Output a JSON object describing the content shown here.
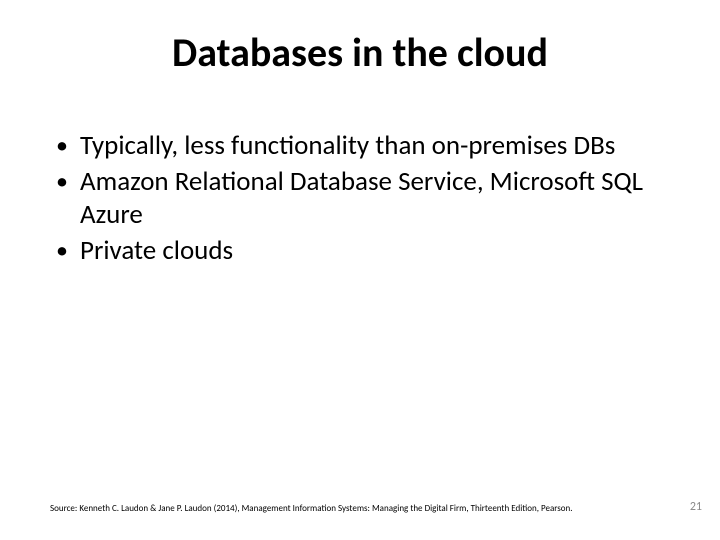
{
  "title": "Databases in the cloud",
  "bullets": [
    "Typically, less functionality than on-premises DBs",
    "Amazon Relational Database Service, Microsoft SQL Azure",
    "Private clouds"
  ],
  "source": "Source: Kenneth C. Laudon & Jane P. Laudon (2014), Management Information Systems: Managing the Digital Firm, Thirteenth Edition, Pearson.",
  "page_number": "21"
}
